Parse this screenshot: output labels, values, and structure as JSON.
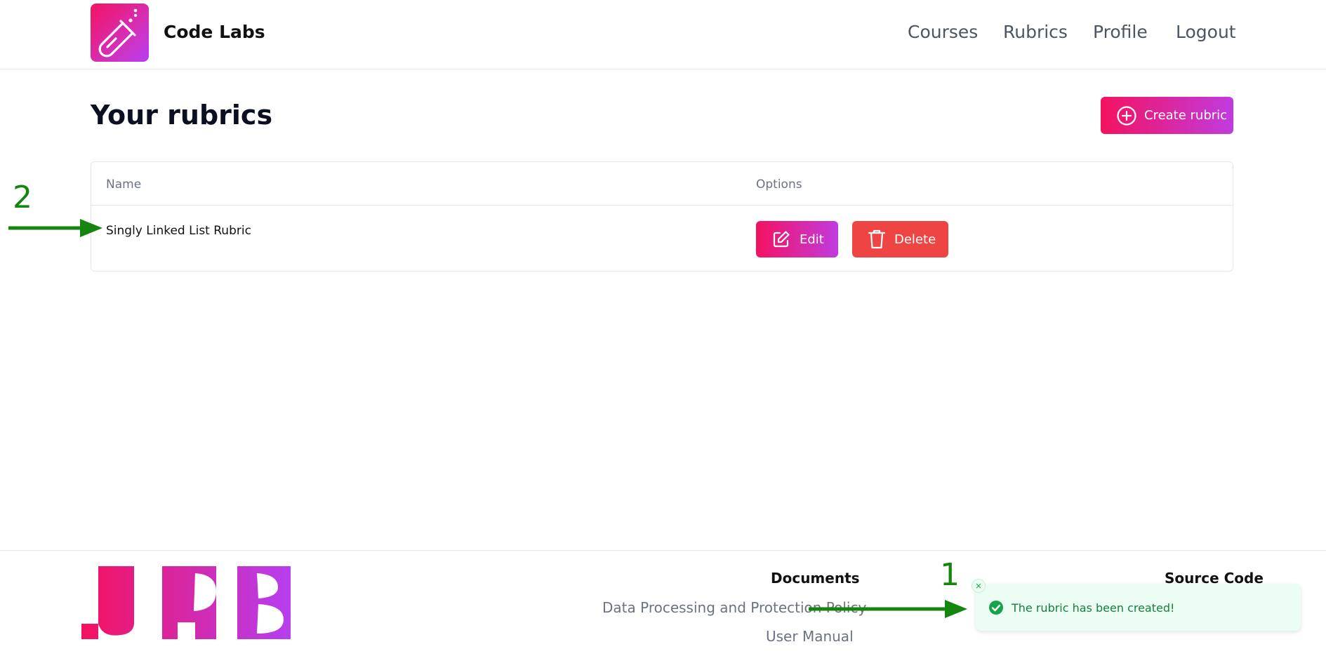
{
  "header": {
    "brand": "Code Labs",
    "nav": [
      "Courses",
      "Rubrics",
      "Profile",
      "Logout"
    ]
  },
  "main": {
    "title": "Your rubrics",
    "create_label": "Create rubric",
    "table": {
      "columns": [
        "Name",
        "Options"
      ],
      "rows": [
        {
          "name": "Singly Linked List Rubric",
          "edit_label": "Edit",
          "delete_label": "Delete"
        }
      ]
    }
  },
  "annotations": {
    "num_1": "1",
    "num_2": "2"
  },
  "footer": {
    "logo_text": "UPB",
    "documents_heading": "Documents",
    "links": [
      "Data Processing and Protection Policy",
      "User Manual"
    ],
    "source_heading": "Source Code"
  },
  "toast": {
    "message": "The rubric has been created!",
    "close_symbol": "×"
  },
  "colors": {
    "brand_start": "#f4125f",
    "brand_end": "#b63ef0",
    "delete": "#ef4444",
    "annotation": "#14860f",
    "toast_bg": "#ecfdf3",
    "toast_text": "#15803d"
  }
}
